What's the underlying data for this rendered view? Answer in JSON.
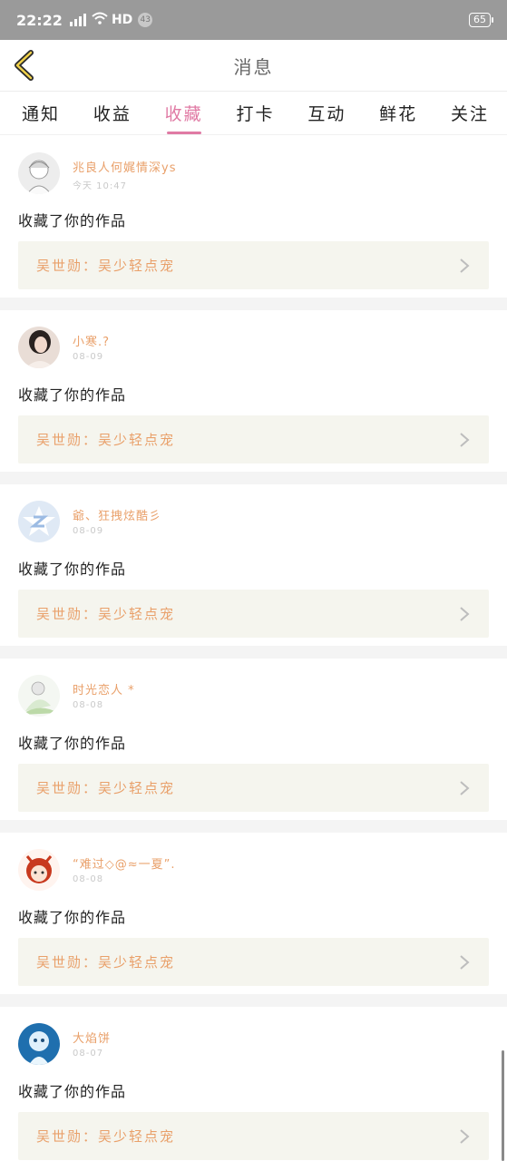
{
  "status_bar": {
    "time": "22:22",
    "network": "HD",
    "notif_count": "43",
    "battery": "65"
  },
  "header": {
    "title": "消息"
  },
  "tabs": [
    {
      "label": "通知",
      "active": false
    },
    {
      "label": "收益",
      "active": false
    },
    {
      "label": "收藏",
      "active": true
    },
    {
      "label": "打卡",
      "active": false
    },
    {
      "label": "互动",
      "active": false
    },
    {
      "label": "鲜花",
      "active": false
    },
    {
      "label": "关注",
      "active": false
    }
  ],
  "colors": {
    "accent": "#e07aa4",
    "name": "#e9a06a",
    "work_bg": "#f5f5ee"
  },
  "items": [
    {
      "name": "兆良人何娓情深ys",
      "date": "今天 10:47",
      "action": "收藏了你的作品",
      "work": "吴世勋：吴少轻点宠"
    },
    {
      "name": "小寒.?",
      "date": "08-09",
      "action": "收藏了你的作品",
      "work": "吴世勋：吴少轻点宠"
    },
    {
      "name": "爺、狂拽炫酷彡",
      "date": "08-09",
      "action": "收藏了你的作品",
      "work": "吴世勋：吴少轻点宠"
    },
    {
      "name": "时光恋人 *",
      "date": "08-08",
      "action": "收藏了你的作品",
      "work": "吴世勋：吴少轻点宠"
    },
    {
      "name": "“难过◇@≈一夏”.",
      "date": "08-08",
      "action": "收藏了你的作品",
      "work": "吴世勋：吴少轻点宠"
    },
    {
      "name": "大焰饼",
      "date": "08-07",
      "action": "收藏了你的作品",
      "work": "吴世勋：吴少轻点宠"
    }
  ]
}
